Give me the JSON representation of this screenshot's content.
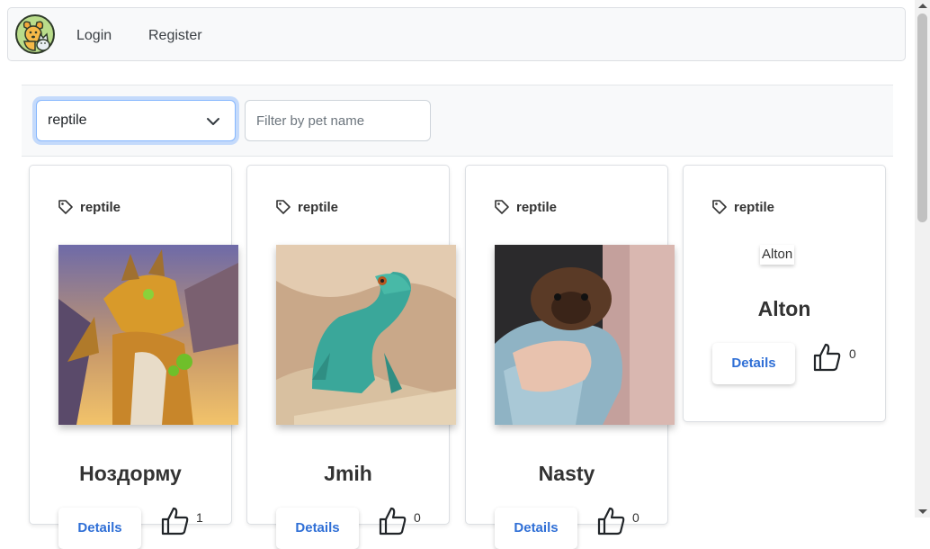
{
  "nav": {
    "login": "Login",
    "register": "Register"
  },
  "filter": {
    "category_value": "reptile",
    "search_placeholder": "Filter by pet name"
  },
  "pets": [
    {
      "tag": "reptile",
      "name": "Ноздорму",
      "likes": "1",
      "details": "Details"
    },
    {
      "tag": "reptile",
      "name": "Jmih",
      "likes": "0",
      "details": "Details"
    },
    {
      "tag": "reptile",
      "name": "Nasty",
      "likes": "0",
      "details": "Details"
    },
    {
      "tag": "reptile",
      "name": "Alton",
      "likes": "0",
      "details": "Details",
      "image_alt": "Alton"
    }
  ],
  "colors": {
    "accent": "#2f6fd6",
    "focus_border": "#86b7fe",
    "nav_bg": "#f8f9fa"
  },
  "icons": [
    "pet-logo-icon",
    "chevron-down-icon",
    "tag-icon",
    "thumbs-up-icon"
  ]
}
